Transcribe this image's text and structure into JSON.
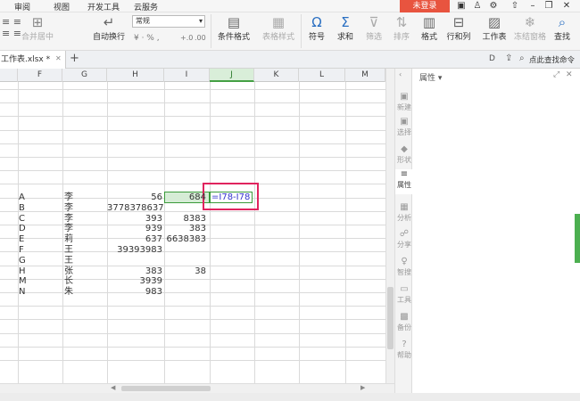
{
  "menubar": {
    "items": [
      "审阅",
      "视图",
      "开发工具",
      "云服务"
    ],
    "login_label": "未登录"
  },
  "ribbon": {
    "merge_label": "合并居中",
    "wrap_label": "自动换行",
    "number_format": "常规",
    "percent_symbols": "¥ · % ,",
    "decimal_inc": "+.0",
    "decimal_dec": ".00",
    "cond_format_label": "条件格式",
    "table_style_label": "表格样式",
    "symbol_label": "符号",
    "sum_label": "求和",
    "filter_label": "筛选",
    "sort_label": "排序",
    "format_label": "格式",
    "rowcol_label": "行和列",
    "sheet_label": "工作表",
    "freeze_label": "冻结窗格",
    "find_label": "查找",
    "icons": [
      "merge-icon",
      "wrap-icon",
      "cond-format-icon",
      "table-style-icon",
      "omega-icon",
      "sigma-icon",
      "filter-icon",
      "sort-icon",
      "format-icon",
      "rowcol-icon",
      "sheet-icon",
      "freeze-icon",
      "find-icon"
    ]
  },
  "tabbar": {
    "file_tab": "工作表.xlsx *",
    "search_label": "点此查找命令"
  },
  "grid": {
    "columns": [
      "F",
      "G",
      "H",
      "I",
      "J",
      "K",
      "L",
      "M"
    ],
    "selected_column": "J",
    "rows": [
      {
        "f": "A",
        "g": "李",
        "h": "56",
        "i": "684"
      },
      {
        "f": "B",
        "g": "李",
        "h": "3778378637",
        "i": ""
      },
      {
        "f": "C",
        "g": "李",
        "h": "393",
        "i": "8383"
      },
      {
        "f": "D",
        "g": "李",
        "h": "939",
        "i": "383"
      },
      {
        "f": "E",
        "g": "莉",
        "h": "637",
        "i": "6638383"
      },
      {
        "f": "F",
        "g": "王",
        "h": "39393983",
        "i": ""
      },
      {
        "f": "G",
        "g": "王",
        "h": "",
        "i": ""
      },
      {
        "f": "H",
        "g": "张",
        "h": "383",
        "i": "38"
      },
      {
        "f": "M",
        "g": "长",
        "h": "3939",
        "i": ""
      },
      {
        "f": "N",
        "g": "朱",
        "h": "983",
        "i": ""
      }
    ],
    "formula": "=I78-I78"
  },
  "sidebar": {
    "items": [
      {
        "label": "新建",
        "icon": "new-icon"
      },
      {
        "label": "选择",
        "icon": "select-icon"
      },
      {
        "label": "形状",
        "icon": "shape-icon"
      },
      {
        "label": "属性",
        "icon": "property-icon"
      },
      {
        "label": "分析",
        "icon": "analyze-icon"
      },
      {
        "label": "分享",
        "icon": "share-icon"
      },
      {
        "label": "智搜",
        "icon": "smart-search-icon"
      },
      {
        "label": "工具",
        "icon": "tool-icon"
      },
      {
        "label": "备份",
        "icon": "backup-icon"
      },
      {
        "label": "帮助",
        "icon": "help-icon"
      }
    ],
    "active": "属性"
  },
  "panel": {
    "title": "属性 ▾"
  },
  "colors": {
    "accent_red": "#e8543f",
    "selection_green": "#3a9b3a",
    "highlight_box": "#e0245e"
  }
}
